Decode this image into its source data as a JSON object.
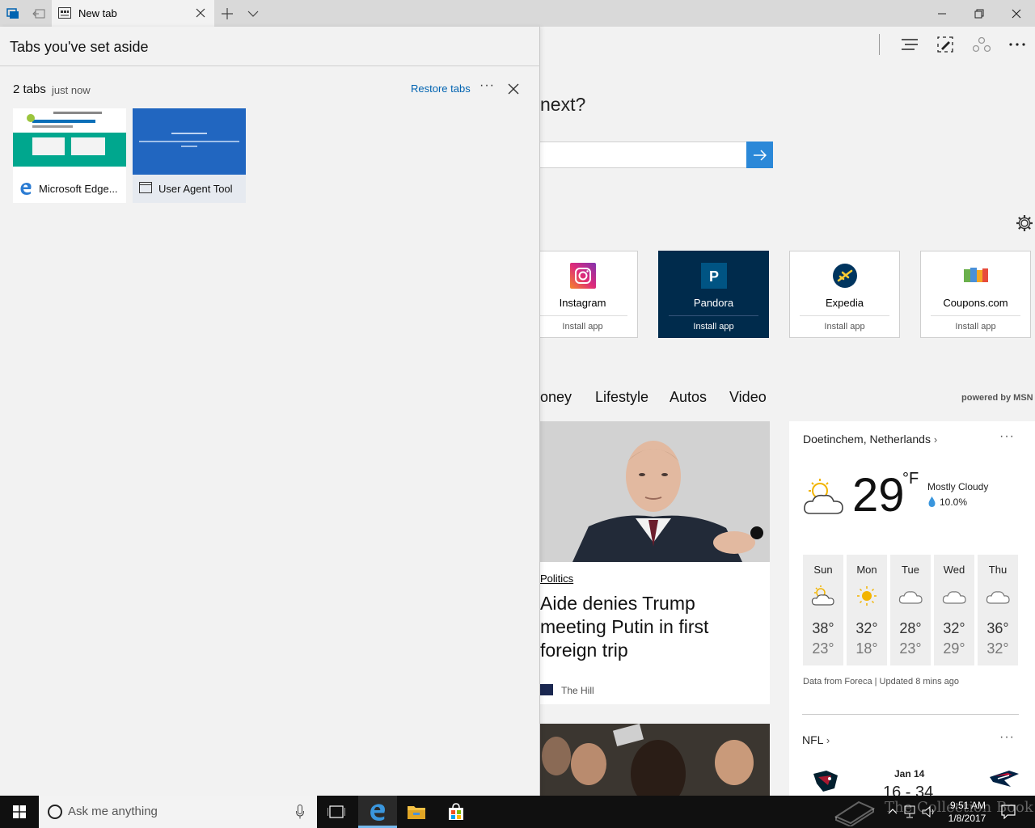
{
  "titlebar": {
    "tab_title": "New tab"
  },
  "panel": {
    "title": "Tabs you've set aside",
    "group_count": "2 tabs",
    "group_time": "just now",
    "restore_label": "Restore tabs",
    "more_label": "···",
    "tabs": [
      {
        "label": "Microsoft Edge...",
        "icon": "edge-icon"
      },
      {
        "label": "User Agent Tool",
        "icon": "page-icon"
      }
    ]
  },
  "content": {
    "search_heading": "next?",
    "apps": [
      {
        "name": "Instagram",
        "install": "Install app",
        "color": "#c13584"
      },
      {
        "name": "Pandora",
        "install": "Install app",
        "color": "#00a0ee",
        "logo_letter": "P"
      },
      {
        "name": "Expedia",
        "install": "Install app",
        "color": "#00355f"
      },
      {
        "name": "Coupons.com",
        "install": "Install app",
        "color": "#6ab04c"
      }
    ],
    "news_categories": [
      "oney",
      "Lifestyle",
      "Autos",
      "Video"
    ],
    "powered_by": "powered by MSN",
    "story": {
      "category": "Politics",
      "headline": "Aide denies Trump meeting Putin in first foreign trip",
      "source": "The Hill"
    },
    "weather": {
      "location": "Doetinchem, Netherlands",
      "temp": "29",
      "unit": "°F",
      "condition": "Mostly Cloudy",
      "precip": "10.0%",
      "forecast": [
        {
          "day": "Sun",
          "hi": "38°",
          "lo": "23°",
          "icon": "sun-cloud-icon"
        },
        {
          "day": "Mon",
          "hi": "32°",
          "lo": "18°",
          "icon": "sun-icon"
        },
        {
          "day": "Tue",
          "hi": "28°",
          "lo": "23°",
          "icon": "cloud-icon"
        },
        {
          "day": "Wed",
          "hi": "32°",
          "lo": "29°",
          "icon": "cloud-icon"
        },
        {
          "day": "Thu",
          "hi": "36°",
          "lo": "32°",
          "icon": "cloud-icon"
        }
      ],
      "credit": "Data from Foreca | Updated 8 mins ago",
      "more_label": "···"
    },
    "nfl": {
      "title": "NFL",
      "date": "Jan 14",
      "score": "16 - 34",
      "more_label": "···"
    }
  },
  "taskbar": {
    "cortana_placeholder": "Ask me anything",
    "time": "9:51 AM",
    "date": "1/8/2017",
    "watermark": "The Collection Book"
  }
}
